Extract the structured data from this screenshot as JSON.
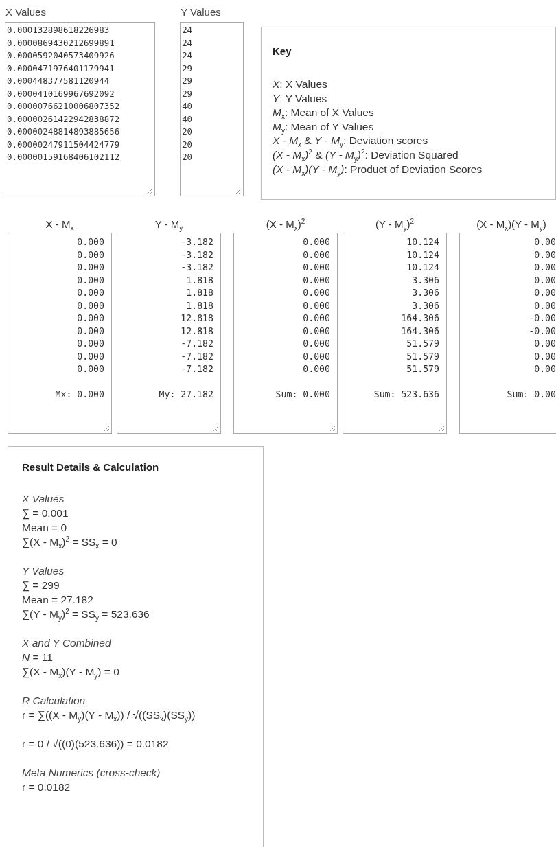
{
  "inputs": [
    {
      "label": "X Values",
      "values": [
        "0.000132898618226983",
        "0.0000869430212699891",
        "0.0000592040573409926",
        "0.0000471976401179941",
        "0.000448377581120944",
        "0.0000410169967692092",
        "0.00000766210006807352",
        "0.00000261422942838872",
        "0.00000248814893885656",
        "0.00000247911504424779",
        "0.00000159168406102112"
      ]
    },
    {
      "label": "Y Values",
      "values": [
        "24",
        "24",
        "24",
        "29",
        "29",
        "29",
        "40",
        "40",
        "20",
        "20",
        "20"
      ]
    }
  ],
  "key": {
    "title": "Key",
    "items": [
      "*X*: X Values",
      "*Y*: Y Values",
      "*M*$_{x}$: Mean of X Values",
      "*M*$_{y}$: Mean of Y Values",
      "*X* - *M*$_{x}$ & *Y* - *M*$_{y}$: Deviation scores",
      "*(X - M*$_{x}$*)*$^{2}$ & *(Y - M*$_{y}$*)*$^{2}$: Deviation Squared",
      "*(X - M*$_{x}$*)(Y - M*$_{y}$*)*: Product of Deviation Scores"
    ]
  },
  "deviations": [
    {
      "heading": "X - M$_{x}$",
      "values": [
        "0.000",
        "0.000",
        "0.000",
        "0.000",
        "0.000",
        "0.000",
        "0.000",
        "0.000",
        "0.000",
        "0.000",
        "0.000"
      ],
      "summary": "Mx: 0.000"
    },
    {
      "heading": "Y - M$_{y}$",
      "values": [
        "-3.182",
        "-3.182",
        "-3.182",
        "1.818",
        "1.818",
        "1.818",
        "12.818",
        "12.818",
        "-7.182",
        "-7.182",
        "-7.182"
      ],
      "summary": "My: 27.182"
    },
    {
      "heading": "(X - M$_{x}$)$^{2}$",
      "values": [
        "0.000",
        "0.000",
        "0.000",
        "0.000",
        "0.000",
        "0.000",
        "0.000",
        "0.000",
        "0.000",
        "0.000",
        "0.000"
      ],
      "summary": "Sum: 0.000"
    },
    {
      "heading": "(Y - M$_{y}$)$^{2}$",
      "values": [
        "10.124",
        "10.124",
        "10.124",
        "3.306",
        "3.306",
        "3.306",
        "164.306",
        "164.306",
        "51.579",
        "51.579",
        "51.579"
      ],
      "summary": "Sum: 523.636"
    },
    {
      "heading": "(X - M$_{x}$)(Y - M$_{y}$)",
      "values": [
        "0.00",
        "0.00",
        "0.00",
        "0.00",
        "0.00",
        "0.00",
        "-0.00",
        "-0.00",
        "0.00",
        "0.00",
        "0.00"
      ],
      "summary": "Sum: 0.00"
    }
  ],
  "results": {
    "title": "Result Details & Calculation",
    "sections": [
      {
        "heading": "X Values",
        "lines": [
          "∑ = 0.001",
          "Mean = 0",
          "∑(X - M$_{x}$)$^{2}$ = SS$_{x}$ = 0"
        ]
      },
      {
        "heading": "Y Values",
        "lines": [
          "∑ = 299",
          "Mean = 27.182",
          "∑(Y - M$_{y}$)$^{2}$ = SS$_{y}$ = 523.636"
        ]
      },
      {
        "heading": "X and Y Combined",
        "lines": [
          "*N* = 11",
          "∑(X - M$_{x}$)(Y - M$_{y}$) = 0"
        ]
      },
      {
        "heading": "R Calculation",
        "lines": [
          "r = ∑((X - M$_{y}$)(Y - M$_{x}$)) / √((SS$_{x}$)(SS$_{y}$))"
        ]
      },
      {
        "lines": [
          "r = 0 / √((0)(523.636)) = 0.0182"
        ]
      },
      {
        "heading": "Meta Numerics (cross-check)",
        "lines": [
          "r = 0.0182"
        ]
      }
    ]
  }
}
